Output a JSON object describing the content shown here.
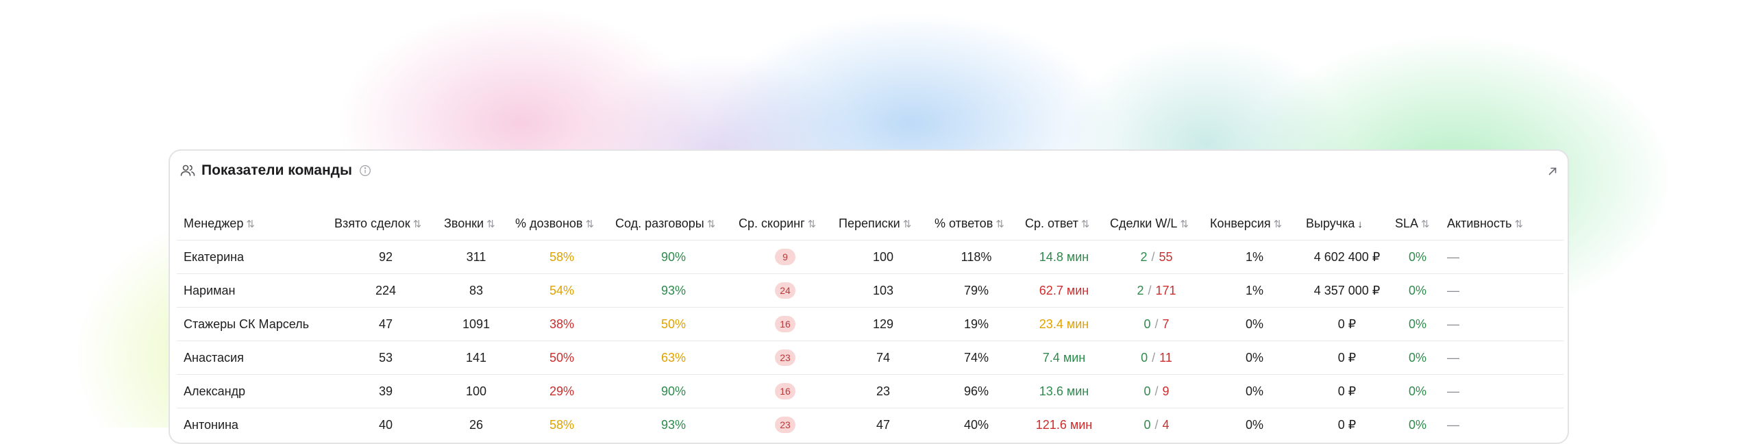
{
  "widget": {
    "title": "Показатели команды",
    "icons": {
      "header": "users-icon",
      "info": "info-icon",
      "expand": "expand-arrow-icon",
      "sort": "sort-arrows-icon"
    }
  },
  "table": {
    "columns": [
      {
        "label": "Менеджер",
        "sort": "⇅"
      },
      {
        "label": "Взято сделок",
        "sort": "⇅"
      },
      {
        "label": "Звонки",
        "sort": "⇅"
      },
      {
        "label": "% дозвонов",
        "sort": "⇅"
      },
      {
        "label": "Сод. разговоры",
        "sort": "⇅"
      },
      {
        "label": "Ср. скоринг",
        "sort": "⇅"
      },
      {
        "label": "Переписки",
        "sort": "⇅"
      },
      {
        "label": "% ответов",
        "sort": "⇅"
      },
      {
        "label": "Ср. ответ",
        "sort": "⇅"
      },
      {
        "label": "Сделки W/L",
        "sort": "⇅"
      },
      {
        "label": "Конверсия",
        "sort": "⇅"
      },
      {
        "label": "Выручка",
        "sort": "↓"
      },
      {
        "label": "SLA",
        "sort": "⇅"
      },
      {
        "label": "Активность",
        "sort": "⇅"
      }
    ],
    "wl_separator": "/",
    "rows": [
      {
        "manager": "Екатерина",
        "deals": "92",
        "calls": "311",
        "dial_rate": "58%",
        "conversations": "90%",
        "scoring": "9",
        "chats": "100",
        "reply_rate": "118%",
        "avg_reply": "14.8 мин",
        "won": "2",
        "lost": "55",
        "conversion": "1%",
        "revenue": "4 602 400 ₽",
        "sla": "0%",
        "activity": "—"
      },
      {
        "manager": "Нариман",
        "deals": "224",
        "calls": "83",
        "dial_rate": "54%",
        "conversations": "93%",
        "scoring": "24",
        "chats": "103",
        "reply_rate": "79%",
        "avg_reply": "62.7 мин",
        "won": "2",
        "lost": "171",
        "conversion": "1%",
        "revenue": "4 357 000 ₽",
        "sla": "0%",
        "activity": "—"
      },
      {
        "manager": "Стажеры СК Марсель",
        "deals": "47",
        "calls": "1091",
        "dial_rate": "38%",
        "conversations": "50%",
        "scoring": "16",
        "chats": "129",
        "reply_rate": "19%",
        "avg_reply": "23.4 мин",
        "won": "0",
        "lost": "7",
        "conversion": "0%",
        "revenue": "0 ₽",
        "sla": "0%",
        "activity": "—"
      },
      {
        "manager": "Анастасия",
        "deals": "53",
        "calls": "141",
        "dial_rate": "50%",
        "conversations": "63%",
        "scoring": "23",
        "chats": "74",
        "reply_rate": "74%",
        "avg_reply": "7.4 мин",
        "won": "0",
        "lost": "11",
        "conversion": "0%",
        "revenue": "0 ₽",
        "sla": "0%",
        "activity": "—"
      },
      {
        "manager": "Александр",
        "deals": "39",
        "calls": "100",
        "dial_rate": "29%",
        "conversations": "90%",
        "scoring": "16",
        "chats": "23",
        "reply_rate": "96%",
        "avg_reply": "13.6 мин",
        "won": "0",
        "lost": "9",
        "conversion": "0%",
        "revenue": "0 ₽",
        "sla": "0%",
        "activity": "—"
      },
      {
        "manager": "Антонина",
        "deals": "40",
        "calls": "26",
        "dial_rate": "58%",
        "conversations": "93%",
        "scoring": "23",
        "chats": "47",
        "reply_rate": "40%",
        "avg_reply": "121.6 мин",
        "won": "0",
        "lost": "4",
        "conversion": "0%",
        "revenue": "0 ₽",
        "sla": "0%",
        "activity": "—"
      }
    ]
  },
  "colors": {
    "good": "#2e8a4c",
    "warn": "#e0a200",
    "bad": "#cc2d2d",
    "badge_bg": "#f9d6d6",
    "badge_text": "#b8393a"
  }
}
